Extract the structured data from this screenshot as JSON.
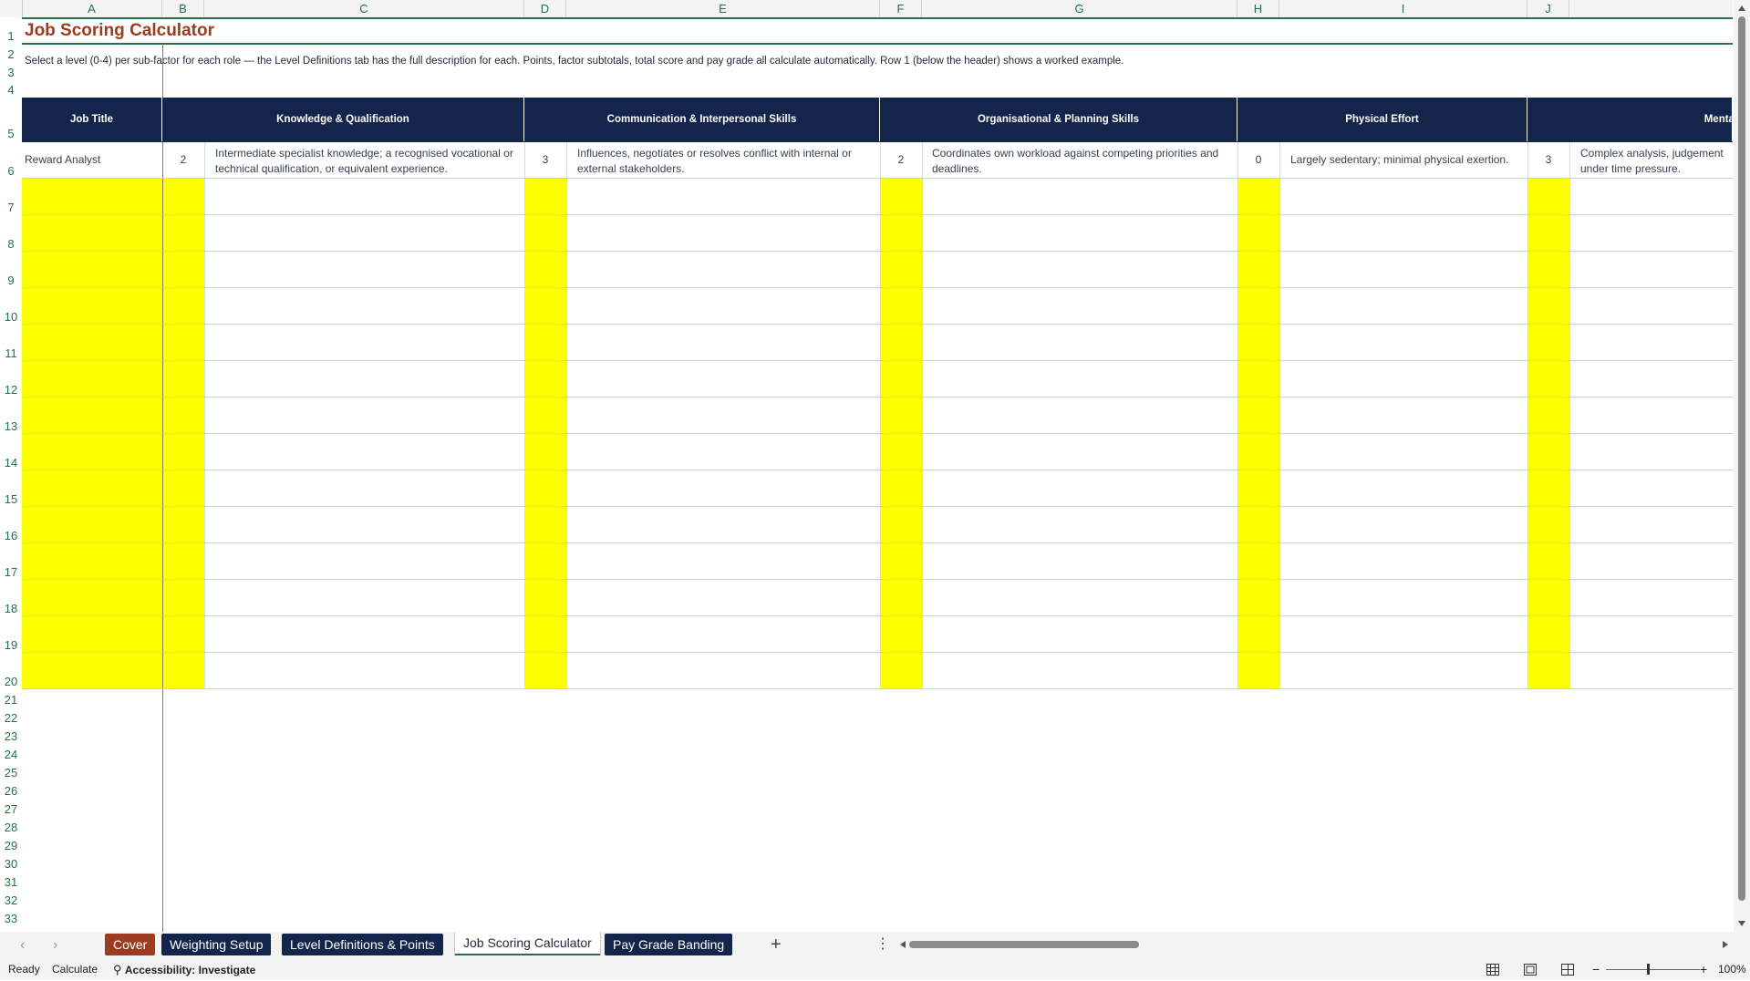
{
  "columns": [
    "A",
    "B",
    "C",
    "D",
    "E",
    "F",
    "G",
    "H",
    "I",
    "J"
  ],
  "rows": [
    "1",
    "2",
    "3",
    "4",
    "5",
    "6",
    "7",
    "8",
    "9",
    "10",
    "11",
    "12",
    "13",
    "14",
    "15",
    "16",
    "17",
    "18",
    "19",
    "20",
    "21",
    "22",
    "23",
    "24",
    "25",
    "26",
    "27",
    "28",
    "29",
    "30",
    "31",
    "32",
    "33"
  ],
  "sheet": {
    "title": "Job Scoring Calculator",
    "instructions": "Select a level (0-4) per sub-factor for each role — the Level Definitions tab has the full description for each. Points, factor subtotals, total score and pay grade all calculate automatically. Row 1 (below the header) shows a worked example.",
    "headers": {
      "job_title": "Job Title",
      "knowledge": "Knowledge & Qualification",
      "communication": "Communication & Interpersonal Skills",
      "organisational": "Organisational & Planning Skills",
      "physical": "Physical Effort",
      "mental": "Mental Effort"
    },
    "example_row": {
      "job_title": "Reward Analyst",
      "knowledge_level": "2",
      "knowledge_desc": "Intermediate specialist knowledge; a recognised vocational or technical qualification, or equivalent experience.",
      "communication_level": "3",
      "communication_desc": "Influences, negotiates or resolves conflict with internal or external stakeholders.",
      "organisational_level": "2",
      "organisational_desc": "Coordinates own workload against competing priorities and deadlines.",
      "physical_level": "0",
      "physical_desc": "Largely sedentary; minimal physical exertion.",
      "mental_level": "3",
      "mental_desc": "Complex analysis, judgement under time pressure."
    }
  },
  "tabs": [
    {
      "label": "Cover",
      "color": "#9c3b1f"
    },
    {
      "label": "Weighting Setup",
      "color": "#13254a"
    },
    {
      "label": "Level Definitions & Points",
      "color": "#13254a"
    },
    {
      "label": "Job Scoring Calculator",
      "active": true
    },
    {
      "label": "Pay Grade Banding",
      "color": "#13254a"
    }
  ],
  "status": {
    "ready": "Ready",
    "calculate": "Calculate",
    "accessibility": "Accessibility: Investigate",
    "zoom": "100%"
  },
  "colors": {
    "header_navy": "#13254a",
    "title_red": "#9c3b1f",
    "input_yellow": "#ffff00",
    "excel_green": "#217346"
  }
}
